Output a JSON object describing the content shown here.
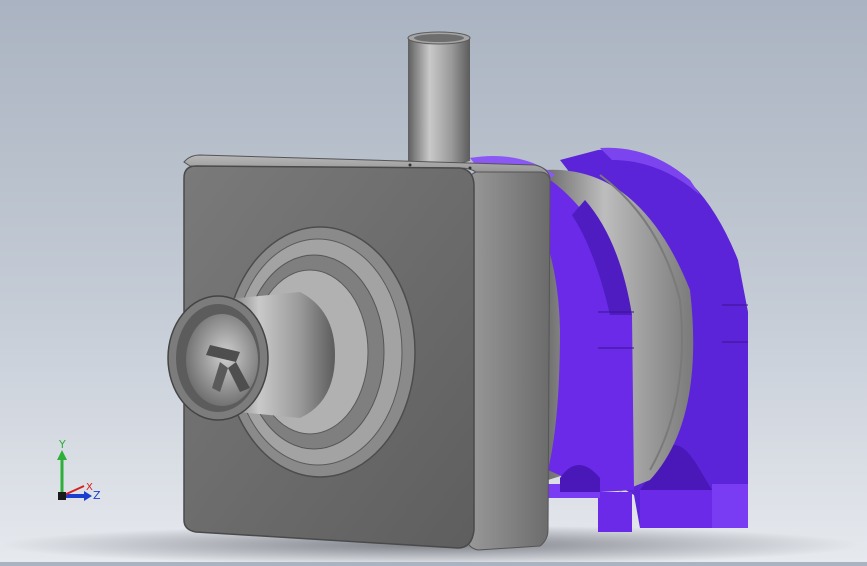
{
  "triad": {
    "y_label": "Y",
    "x_label": "X",
    "z_label": "Z",
    "colors": {
      "x": "#d81e1e",
      "y": "#2fae3a",
      "z": "#1a3fd0"
    }
  },
  "model": {
    "housing_color": "#8c8c8c",
    "bracket_color": "#6a2ae8"
  }
}
